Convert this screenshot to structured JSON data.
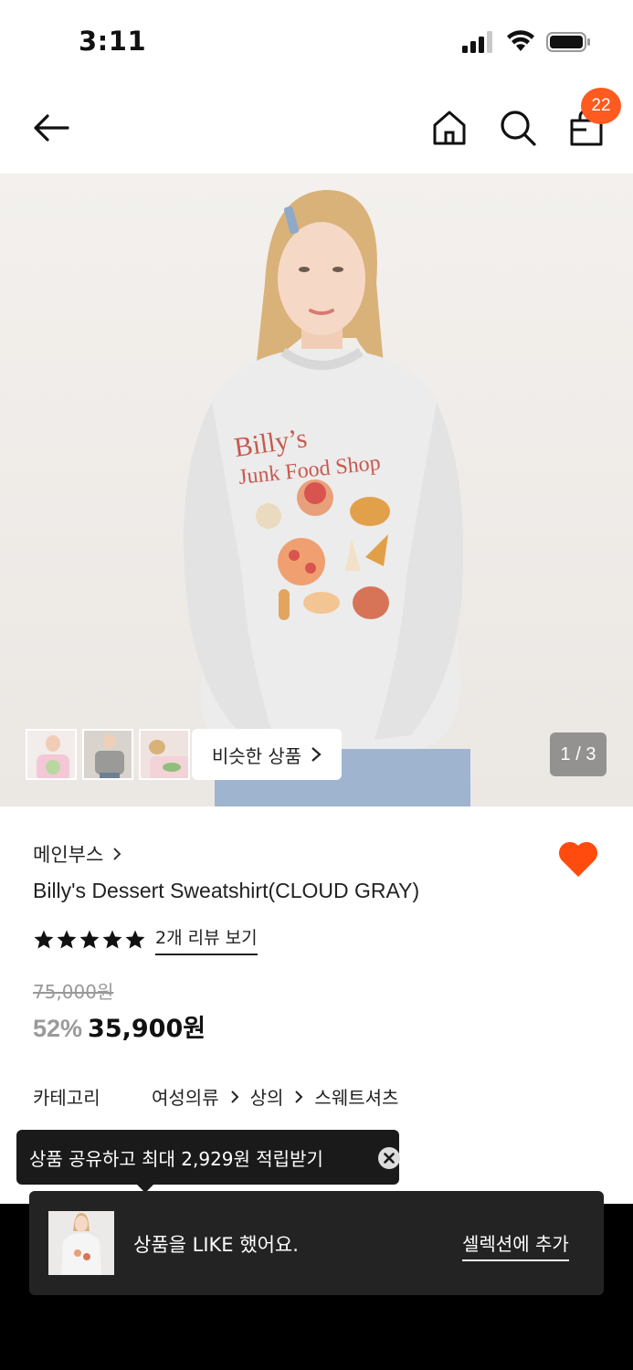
{
  "status_bar": {
    "time": "3:11"
  },
  "header": {
    "cart_count": "22"
  },
  "gallery": {
    "similar_label": "비슷한 상품",
    "page_indicator": "1 / 3",
    "thumbnails": [
      "thumbnail-1",
      "thumbnail-2",
      "thumbnail-3"
    ]
  },
  "product": {
    "brand": "메인부스",
    "name": "Billy's Dessert Sweatshirt(CLOUD GRAY)",
    "rating": 5,
    "review_link": "2개 리뷰 보기",
    "original_price": "75,000원",
    "discount": "52%",
    "price": "35,900원",
    "liked": true,
    "category_label": "카테고리",
    "categories": [
      "여성의류",
      "상의",
      "스웨트셔츠"
    ]
  },
  "tooltip": {
    "text": "상품 공유하고 최대 2,929원 적립받기"
  },
  "toast": {
    "message": "상품을 LIKE 했어요.",
    "action": "셀렉션에 추가"
  },
  "colors": {
    "accent": "#ff5a1f",
    "toast_bg": "#232323",
    "tooltip_bg": "#1a1a1a"
  }
}
